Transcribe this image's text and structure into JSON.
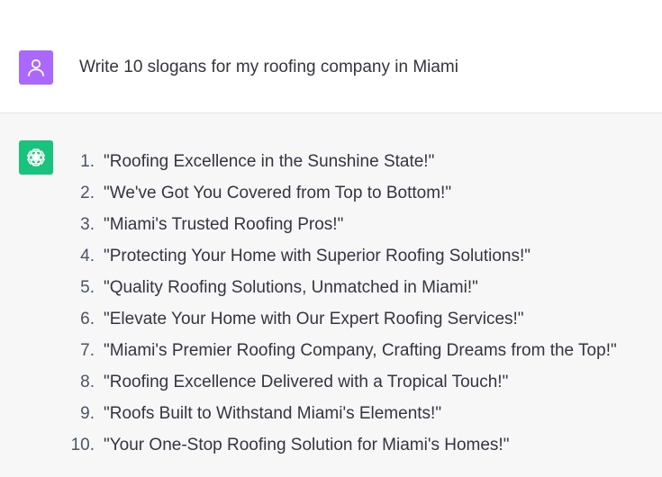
{
  "user_message": {
    "avatar_icon": "user-icon",
    "text": "Write 10 slogans for my roofing company in Miami"
  },
  "assistant_message": {
    "avatar_icon": "openai-logo-icon",
    "items": [
      {
        "num": "1.",
        "text": "\"Roofing Excellence in the Sunshine State!\""
      },
      {
        "num": "2.",
        "text": "\"We've Got You Covered from Top to Bottom!\""
      },
      {
        "num": "3.",
        "text": "\"Miami's Trusted Roofing Pros!\""
      },
      {
        "num": "4.",
        "text": "\"Protecting Your Home with Superior Roofing Solutions!\""
      },
      {
        "num": "5.",
        "text": "\"Quality Roofing Solutions, Unmatched in Miami!\""
      },
      {
        "num": "6.",
        "text": "\"Elevate Your Home with Our Expert Roofing Services!\""
      },
      {
        "num": "7.",
        "text": "\"Miami's Premier Roofing Company, Crafting Dreams from the Top!\""
      },
      {
        "num": "8.",
        "text": "\"Roofing Excellence Delivered with a Tropical Touch!\""
      },
      {
        "num": "9.",
        "text": "\"Roofs Built to Withstand Miami's Elements!\""
      },
      {
        "num": "10.",
        "text": "\"Your One-Stop Roofing Solution for Miami's Homes!\""
      }
    ]
  },
  "colors": {
    "user_avatar_bg": "#ab68ff",
    "assistant_avatar_bg": "#19c37d",
    "assistant_row_bg": "#f7f7f8"
  }
}
